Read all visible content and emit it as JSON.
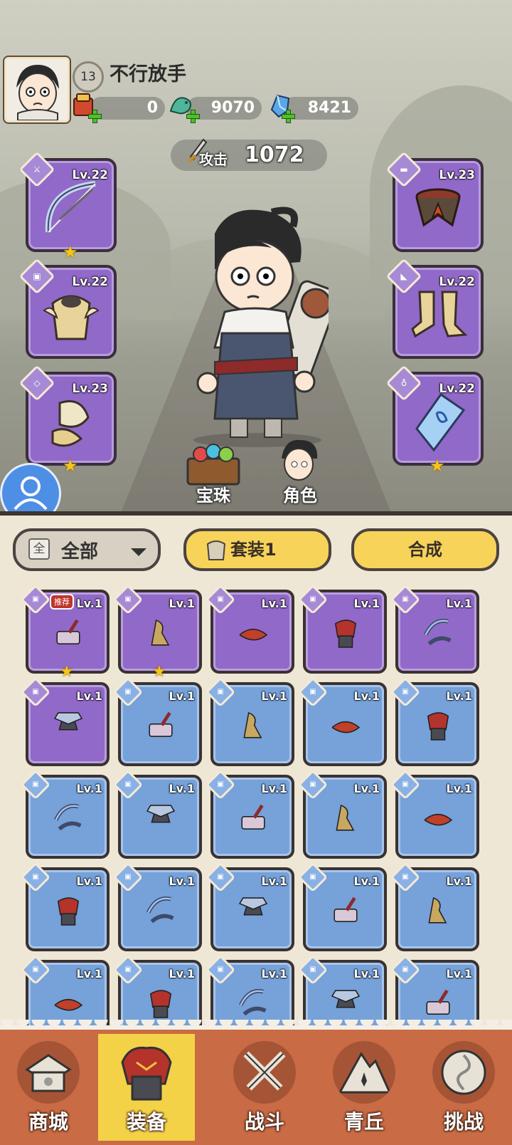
{
  "player": {
    "name": "不行放手",
    "level": "13"
  },
  "resources": {
    "tokens": "0",
    "jade": "9070",
    "crystal": "8421"
  },
  "attack": {
    "label": "攻击",
    "value": "1072"
  },
  "equipped": [
    {
      "lv": "Lv.22",
      "star": true,
      "icon": "bow-icon"
    },
    {
      "lv": "Lv.22",
      "star": false,
      "icon": "armor-icon"
    },
    {
      "lv": "Lv.23",
      "star": true,
      "icon": "bracer-icon"
    },
    {
      "lv": "Lv.23",
      "star": false,
      "icon": "belt-icon"
    },
    {
      "lv": "Lv.22",
      "star": false,
      "icon": "boots-icon"
    },
    {
      "lv": "Lv.22",
      "star": true,
      "icon": "pendant-icon"
    }
  ],
  "character_buttons": {
    "orb": "宝珠",
    "role": "角色"
  },
  "filter": {
    "box": "全",
    "label": "全部"
  },
  "buttons": {
    "set": "套装1",
    "forge": "合成"
  },
  "recommend_badge": "推荐",
  "inventory": [
    {
      "lv": "Lv.1",
      "rarity": "p",
      "star": true
    },
    {
      "lv": "Lv.1",
      "rarity": "p",
      "star": true
    },
    {
      "lv": "Lv.1",
      "rarity": "p",
      "star": false
    },
    {
      "lv": "Lv.1",
      "rarity": "p",
      "star": false
    },
    {
      "lv": "Lv.1",
      "rarity": "p",
      "star": false
    },
    {
      "lv": "Lv.1",
      "rarity": "p",
      "star": false
    },
    {
      "lv": "Lv.1",
      "rarity": "b",
      "star": false
    },
    {
      "lv": "Lv.1",
      "rarity": "b",
      "star": false
    },
    {
      "lv": "Lv.1",
      "rarity": "b",
      "star": false
    },
    {
      "lv": "Lv.1",
      "rarity": "b",
      "star": false
    },
    {
      "lv": "Lv.1",
      "rarity": "b",
      "star": false
    },
    {
      "lv": "Lv.1",
      "rarity": "b",
      "star": false
    },
    {
      "lv": "Lv.1",
      "rarity": "b",
      "star": false
    },
    {
      "lv": "Lv.1",
      "rarity": "b",
      "star": false
    },
    {
      "lv": "Lv.1",
      "rarity": "b",
      "star": false
    },
    {
      "lv": "Lv.1",
      "rarity": "b",
      "star": false
    },
    {
      "lv": "Lv.1",
      "rarity": "b",
      "star": false
    },
    {
      "lv": "Lv.1",
      "rarity": "b",
      "star": false
    },
    {
      "lv": "Lv.1",
      "rarity": "b",
      "star": false
    },
    {
      "lv": "Lv.1",
      "rarity": "b",
      "star": false
    },
    {
      "lv": "Lv.1",
      "rarity": "b",
      "star": false
    },
    {
      "lv": "Lv.1",
      "rarity": "b",
      "star": false
    },
    {
      "lv": "Lv.1",
      "rarity": "b",
      "star": false
    },
    {
      "lv": "Lv.1",
      "rarity": "b",
      "star": false
    },
    {
      "lv": "Lv.1",
      "rarity": "b",
      "star": false
    }
  ],
  "nav": [
    {
      "label": "商城",
      "icon": "shop-icon"
    },
    {
      "label": "装备",
      "icon": "helmet-icon"
    },
    {
      "label": "战斗",
      "icon": "crossed-swords-icon"
    },
    {
      "label": "青丘",
      "icon": "mountain-icon"
    },
    {
      "label": "挑战",
      "icon": "challenge-icon"
    }
  ],
  "colors": {
    "purple": "#9169c8",
    "blue": "#76a1d9",
    "nav": "#c96b44",
    "active": "#f4d248"
  }
}
